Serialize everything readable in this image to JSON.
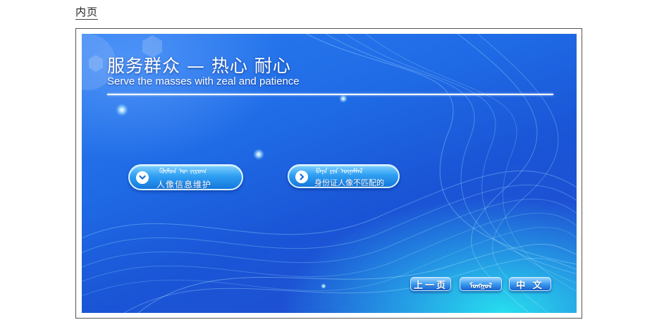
{
  "page_label": "内页",
  "screen": {
    "headline": "服务群众 — 热心 耐心",
    "subline": "Serve the masses with zeal and patience"
  },
  "buttons": [
    {
      "mongolian": "ᠬᠥᠮᠦᠨ ᠦ ᠵᠢᠷᠤᠭ",
      "label": "人像信息维护",
      "icon": "chevron-down-icon"
    },
    {
      "mongolian": "ᠪᠡᠶᠡ ᠶᠢᠨ ᠦᠨᠡᠮᠯᠡᠯ",
      "label": "身份证人像不匹配的",
      "icon": "chevron-right-icon"
    }
  ],
  "nav": {
    "prev": "上一页",
    "mongolian": "ᠮᠣᠩᠭᠣᠯ",
    "chinese": "中 文"
  }
}
